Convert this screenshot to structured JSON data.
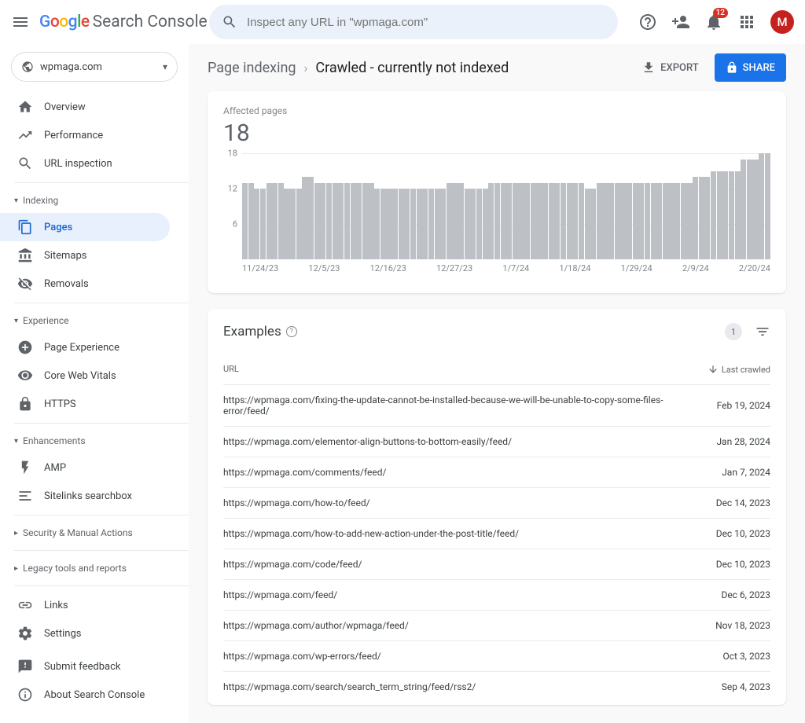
{
  "header": {
    "product_name": "Search Console",
    "search_placeholder": "Inspect any URL in \"wpmaga.com\"",
    "notif_count": "12",
    "avatar_letter": "M"
  },
  "property": {
    "name": "wpmaga.com"
  },
  "sidebar": {
    "items_top": [
      {
        "label": "Overview",
        "icon": "home"
      },
      {
        "label": "Performance",
        "icon": "trend"
      },
      {
        "label": "URL inspection",
        "icon": "search"
      }
    ],
    "sec_indexing": "Indexing",
    "items_indexing": [
      {
        "label": "Pages",
        "icon": "copy"
      },
      {
        "label": "Sitemaps",
        "icon": "sitemap"
      },
      {
        "label": "Removals",
        "icon": "noeye"
      }
    ],
    "sec_experience": "Experience",
    "items_experience": [
      {
        "label": "Page Experience",
        "icon": "plus"
      },
      {
        "label": "Core Web Vitals",
        "icon": "gauge"
      },
      {
        "label": "HTTPS",
        "icon": "lock"
      }
    ],
    "sec_enhance": "Enhancements",
    "items_enhance": [
      {
        "label": "AMP",
        "icon": "bolt"
      },
      {
        "label": "Sitelinks searchbox",
        "icon": "sitelinks"
      }
    ],
    "sec_security": "Security & Manual Actions",
    "sec_legacy": "Legacy tools and reports",
    "items_bottom": [
      {
        "label": "Links",
        "icon": "link"
      },
      {
        "label": "Settings",
        "icon": "gear"
      }
    ],
    "items_footer": [
      {
        "label": "Submit feedback",
        "icon": "feedback"
      },
      {
        "label": "About Search Console",
        "icon": "info"
      }
    ]
  },
  "breadcrumb": {
    "parent": "Page indexing",
    "current": "Crawled - currently not indexed"
  },
  "actions": {
    "export": "EXPORT",
    "share": "SHARE"
  },
  "affected": {
    "label": "Affected pages",
    "value": "18"
  },
  "chart_data": {
    "type": "bar",
    "ylabel": "",
    "xlabel": "",
    "ylim": [
      0,
      18
    ],
    "y_ticks": [
      "18",
      "12",
      "6"
    ],
    "categories": [
      "11/24/23",
      "12/5/23",
      "12/16/23",
      "12/27/23",
      "1/7/24",
      "1/18/24",
      "1/29/24",
      "2/9/24",
      "2/20/24"
    ],
    "values": [
      13,
      13,
      12,
      12,
      13,
      13,
      13,
      12,
      12,
      12,
      14,
      14,
      13,
      13,
      13,
      13,
      13,
      13,
      13,
      13,
      13,
      13,
      12,
      12,
      12,
      12,
      12,
      12,
      12,
      12,
      12,
      12,
      12,
      12,
      13,
      13,
      13,
      12,
      12,
      12,
      12,
      13,
      13,
      13,
      13,
      13,
      13,
      13,
      13,
      13,
      13,
      13,
      13,
      13,
      13,
      13,
      13,
      12,
      12,
      13,
      13,
      13,
      13,
      13,
      13,
      13,
      13,
      13,
      13,
      13,
      13,
      13,
      13,
      13,
      13,
      14,
      14,
      14,
      15,
      15,
      15,
      15,
      15,
      17,
      17,
      17,
      18,
      18
    ],
    "title": "Affected pages"
  },
  "examples": {
    "title": "Examples",
    "page": "1",
    "col_url": "URL",
    "col_date": "Last crawled",
    "rows": [
      {
        "url": "https://wpmaga.com/fixing-the-update-cannot-be-installed-because-we-will-be-unable-to-copy-some-files-error/feed/",
        "date": "Feb 19, 2024"
      },
      {
        "url": "https://wpmaga.com/elementor-align-buttons-to-bottom-easily/feed/",
        "date": "Jan 28, 2024"
      },
      {
        "url": "https://wpmaga.com/comments/feed/",
        "date": "Jan 7, 2024"
      },
      {
        "url": "https://wpmaga.com/how-to/feed/",
        "date": "Dec 14, 2023"
      },
      {
        "url": "https://wpmaga.com/how-to-add-new-action-under-the-post-title/feed/",
        "date": "Dec 10, 2023"
      },
      {
        "url": "https://wpmaga.com/code/feed/",
        "date": "Dec 10, 2023"
      },
      {
        "url": "https://wpmaga.com/feed/",
        "date": "Dec 6, 2023"
      },
      {
        "url": "https://wpmaga.com/author/wpmaga/feed/",
        "date": "Nov 18, 2023"
      },
      {
        "url": "https://wpmaga.com/wp-errors/feed/",
        "date": "Oct 3, 2023"
      },
      {
        "url": "https://wpmaga.com/search/search_term_string/feed/rss2/",
        "date": "Sep 4, 2023"
      }
    ]
  }
}
